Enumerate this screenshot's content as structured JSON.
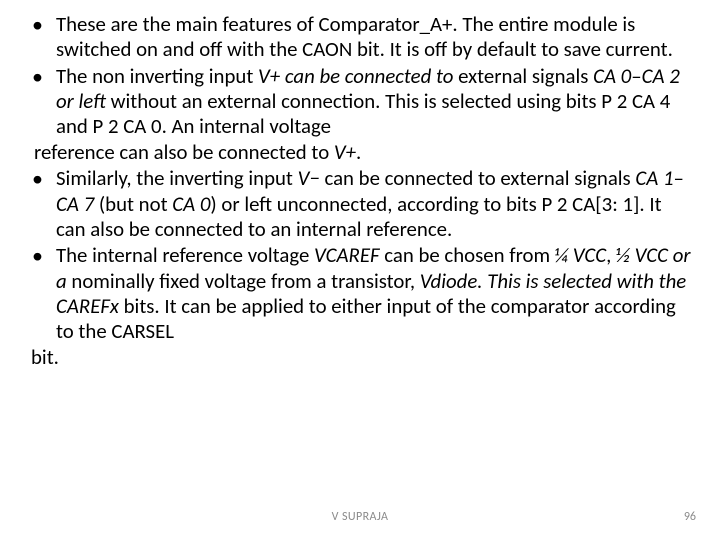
{
  "bullets": {
    "b1": "These are the main features of Comparator_A+. The entire module is switched on and off with the CAON bit. It is off by default to save current.",
    "b2_a": "The non inverting input ",
    "b2_b": "V+ can be connected to ",
    "b2_c": "external signals ",
    "b2_d": "CA 0",
    "b2_e": "–",
    "b2_f": "CA 2 or left ",
    "b2_g": "without an external connection. This is selected using bits P 2 CA 4 and P 2 CA 0. An internal voltage",
    "b2_h": " reference can also be connected to ",
    "b2_i": "V+",
    "b2_j": ".",
    "b3_a": "Similarly, the inverting input ",
    "b3_b": "V− ",
    "b3_c": "can be connected to external signals ",
    "b3_d": "CA 1",
    "b3_e": "–",
    "b3_f": "CA 7 ",
    "b3_g": "(but not ",
    "b3_h": "CA 0",
    "b3_i": ") or left unconnected, according to bits P 2 CA[3: 1]. It can also be connected to an internal reference.",
    "b4_a": "The internal reference voltage ",
    "b4_b": "VCAREF ",
    "b4_c": "can be chosen from ",
    "b4_d": "¼ VCC",
    "b4_e": ", ",
    "b4_f": "½ VCC or a ",
    "b4_g": "nominally fixed voltage from a transistor, ",
    "b4_h": "Vdiode",
    "b4_i": ". This is selected with the ",
    "b4_j": "CAREFx ",
    "b4_k": "bits. It can be applied to either input of the comparator according to the CARSEL",
    "b4_l": "bit."
  },
  "footer": {
    "author": "V SUPRAJA",
    "page": "96"
  }
}
